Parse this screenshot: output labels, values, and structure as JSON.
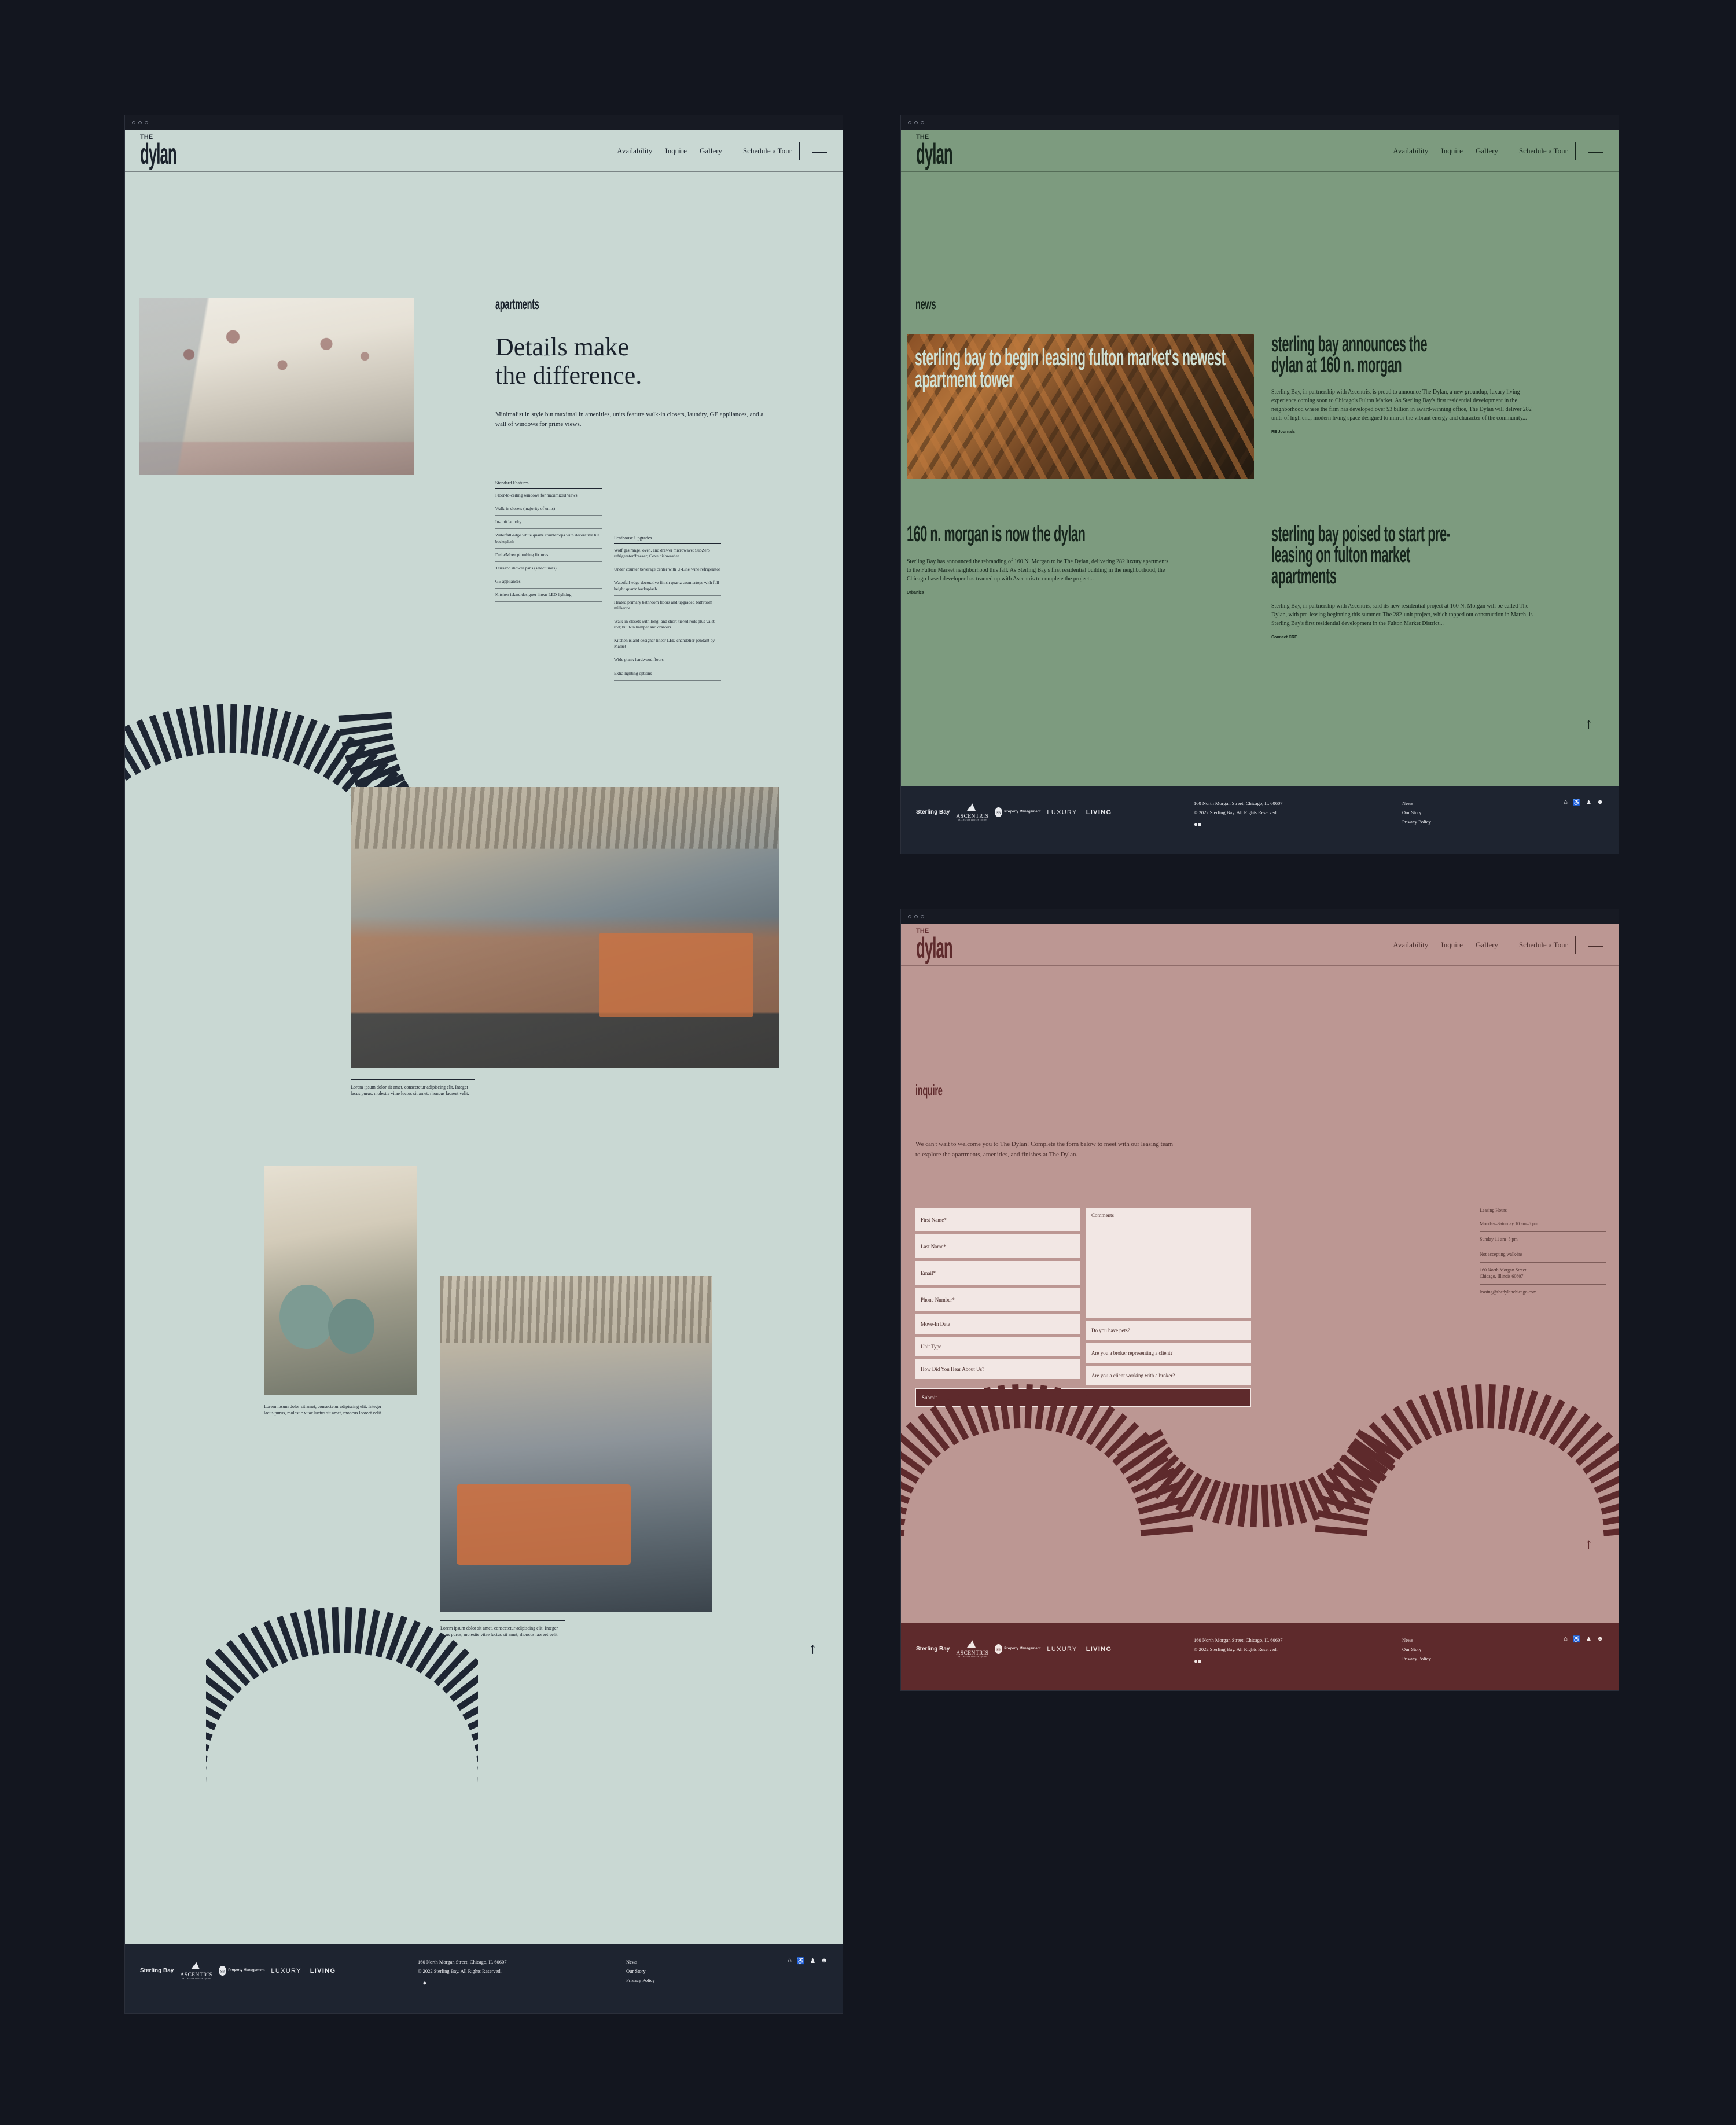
{
  "brand": {
    "logo_the": "THE",
    "logo_name": "dylan"
  },
  "colors": {
    "desktop_bg": "#13161f",
    "mint": "#c9d8d3",
    "green": "#7d9b7f",
    "rose": "#bc9793",
    "ink": "#1a222c",
    "footer_dark": "#1e2430",
    "footer_maroon": "#5e2a2c",
    "field_cream": "#f2e7e4"
  },
  "nav": {
    "items": [
      {
        "label": "Availability"
      },
      {
        "label": "Inquire"
      },
      {
        "label": "Gallery"
      }
    ],
    "cta": "Schedule a Tour",
    "menu_icon": "hamburger-icon"
  },
  "apartments_page": {
    "eyebrow": "apartments",
    "headline_line1": "Details make",
    "headline_line2": "the difference.",
    "intro": "Minimalist in style but maximal in amenities, units feature walk-in closets, laundry, GE appliances, and a wall of windows for prime views.",
    "standard_features": {
      "title": "Standard Features",
      "items": [
        "Floor-to-ceiling windows for maximized views",
        "Walk-in closets (majority of units)",
        "In-unit laundry",
        "Waterfall-edge white quartz countertops with decorative tile backsplash",
        "Delta/Moen plumbing fixtures",
        "Terrazzo shower pans (select units)",
        "GE appliances",
        "Kitchen island designer linear LED lighting"
      ]
    },
    "penthouse_upgrades": {
      "title": "Penthouse Upgrades",
      "items": [
        "Wolf gas range, oven, and drawer microwave; SubZero refrigerator/freezer; Cove dishwasher",
        "Under counter beverage center with U-Line wine refrigerator",
        "Waterfall-edge decorative finish quartz countertops with full-height quartz backsplash",
        "Heated primary bathroom floors and upgraded bathroom millwork",
        "Walk-in closets with long- and short-tiered rods plus valet rod; built-in hamper and drawers",
        "Kitchen island designer linear LED chandelier pendant by Marset",
        "Wide plank hardwood floors",
        "Extra lighting options"
      ]
    },
    "captions": [
      "Lorem ipsum dolor sit amet, consectetur adipiscing elit. Integer lacus purus, molestie vitae luctus sit amet, rhoncus laoreet velit.",
      "Lorem ipsum dolor sit amet, consectetur adipiscing elit. Integer lacus purus, molestie vitae luctus sit amet, rhoncus laoreet velit.",
      "Lorem ipsum dolor sit amet, consectetur adipiscing elit. Integer lacus purus, molestie vitae luctus sit amet, rhoncus laoreet velit."
    ],
    "back_to_top": "↑"
  },
  "news_page": {
    "eyebrow": "news",
    "articles": [
      {
        "title": "sterling bay to begin leasing fulton market's newest apartment tower",
        "overlay": true,
        "body": "",
        "source": ""
      },
      {
        "title_line1": "sterling bay announces the",
        "title_line2": "dylan at 160 n. morgan",
        "body": "Sterling Bay, in partnership with Ascentris, is proud to announce The Dylan, a new groundup, luxury living experience coming soon to Chicago's Fulton Market. As Sterling Bay's first residential development in the neighborhood where the firm has developed over $3 billion in award-winning office, The Dylan will deliver 282 units of high end, modern living space designed to mirror the vibrant energy and character of the community...",
        "source": "RE Journals"
      },
      {
        "title_line1": "160 n. morgan is now the dylan",
        "body": "Sterling Bay has announced the rebranding of 160 N. Morgan to be The Dylan, delivering 282 luxury apartments to the Fulton Market neighborhood this fall. As Sterling Bay's first residential building in the neighborhood, the Chicago-based developer has teamed up with Ascentris to complete the project...",
        "source": "Urbanize"
      },
      {
        "title_line1": "sterling bay poised to start pre-",
        "title_line2": "leasing on fulton market",
        "title_line3": "apartments",
        "body": "Sterling Bay, in partnership with Ascentris, said its new residential project at 160 N. Morgan will be called The Dylan, with pre-leasing beginning this summer. The 282-unit project, which topped out construction in March, is Sterling Bay's first residential development in the Fulton Market District...",
        "source": "Connect CRE"
      }
    ],
    "back_to_top": "↑"
  },
  "inquire_page": {
    "eyebrow": "inquire",
    "intro": "We can't wait to welcome you to The Dylan! Complete the form below to meet with our leasing team to explore the apartments, amenities, and finishes at The Dylan.",
    "form": {
      "left_fields": [
        "First Name*",
        "Last Name*",
        "Email*",
        "Phone Number*",
        "Move-In Date",
        "Unit Type",
        "How Did You Hear About Us?"
      ],
      "comments_placeholder": "Comments",
      "right_fields": [
        "Do you have pets?",
        "Are you a broker representing a client?",
        "Are you a client working with a broker?"
      ],
      "submit_label": "Submit"
    },
    "leasing": {
      "title": "Leasing Hours",
      "rows": [
        "Monday–Saturday 10 am–5 pm",
        "Sunday 11 am–5 pm",
        "Not accepting walk-ins",
        "160 North Morgan Street\nChicago, Illinois 60607",
        "leasing@thedylanchicago.com"
      ]
    },
    "back_to_top": "↑"
  },
  "footer": {
    "logos": [
      {
        "name": "sterling-bay-logo",
        "text": "Sterling Bay"
      },
      {
        "name": "ascentris-logo",
        "text": "ASCENTRIS",
        "sub": "REAL ESTATE PRIVATE EQUITY"
      },
      {
        "name": "property-management-logo",
        "text": "Property Management"
      },
      {
        "name": "luxury-living-logo",
        "text": "LUXURY",
        "text2": "LIVING"
      }
    ],
    "address": "160 North Morgan Street, Chicago, IL 60607",
    "copyright": "© 2022 Sterling Bay.  All Rights Reserved.",
    "social": [
      "facebook-icon",
      "instagram-icon",
      "twitter-icon",
      "linkedin-icon"
    ],
    "links": [
      "News",
      "Our Story",
      "Privacy Policy"
    ],
    "badges": [
      "fair-housing-icon",
      "accessibility-icon",
      "equal-opportunity-icon",
      "pet-friendly-icon"
    ]
  }
}
